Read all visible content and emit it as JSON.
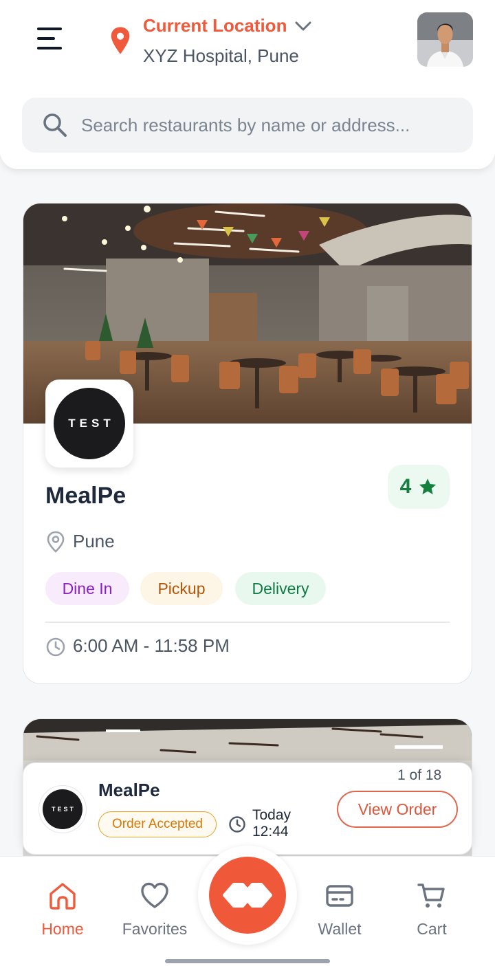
{
  "header": {
    "location_title": "Current Location",
    "location_subtitle": "XYZ Hospital, Pune",
    "search_placeholder": "Search restaurants by name or address..."
  },
  "restaurant": {
    "logo_text": "TEST",
    "name": "MealPe",
    "rating": "4",
    "address": "Pune",
    "tags": [
      "Dine In",
      "Pickup",
      "Delivery"
    ],
    "hours": "6:00 AM - 11:58 PM"
  },
  "order_bar": {
    "logo_text": "TEST",
    "restaurant": "MealPe",
    "status": "Order Accepted",
    "time_day": "Today",
    "time": "12:44",
    "count": "1 of 18",
    "button": "View Order"
  },
  "bottom_nav": {
    "items": [
      {
        "label": "Home",
        "icon": "home-icon",
        "active": true
      },
      {
        "label": "Favorites",
        "icon": "heart-icon",
        "active": false
      },
      {
        "label": "Wallet",
        "icon": "wallet-icon",
        "active": false
      },
      {
        "label": "Cart",
        "icon": "cart-icon",
        "active": false
      }
    ]
  },
  "colors": {
    "accent": "#ef5a3c",
    "rating_green": "#15803d",
    "status_amber": "#d97706"
  }
}
